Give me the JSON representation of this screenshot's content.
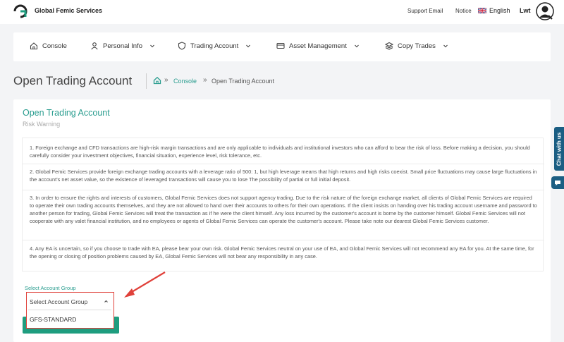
{
  "header": {
    "brand": "Global Femic Services",
    "support_email": "Support Email",
    "notice": "Notice",
    "language": "English",
    "user": "Lwt"
  },
  "nav": {
    "items": [
      {
        "label": "Console",
        "icon": "home-icon",
        "has_dropdown": false
      },
      {
        "label": "Personal Info",
        "icon": "person-icon",
        "has_dropdown": true
      },
      {
        "label": "Trading Account",
        "icon": "shield-icon",
        "has_dropdown": true
      },
      {
        "label": "Asset Management",
        "icon": "card-icon",
        "has_dropdown": true
      },
      {
        "label": "Copy Trades",
        "icon": "layers-icon",
        "has_dropdown": true
      }
    ]
  },
  "page": {
    "title": "Open Trading Account",
    "breadcrumb": {
      "console": "Console",
      "current": "Open Trading Account"
    }
  },
  "card": {
    "title": "Open Trading Account",
    "subtitle": "Risk Warning",
    "paragraphs": [
      "1. Foreign exchange and CFD transactions are high-risk margin transactions and are only applicable to individuals and institutional investors who can afford to bear the risk of loss. Before making a decision, you should carefully consider your investment objectives, financial situation, experience level, risk tolerance, etc.",
      "2. Global Femic Services provide foreign exchange trading accounts with a leverage ratio of 500: 1, but high leverage means that high returns and high risks coexist. Small price fluctuations may cause large fluctuations in the account's net asset value, so the existence of leveraged transactions will cause you to lose The possibility of partial or full initial deposit.",
      "3. In order to ensure the rights and interests of customers, Global Femic Services does not support agency trading. Due to the risk nature of the foreign exchange market, all clients of Global Femic Services are required to operate their own trading accounts themselves, and they are not allowed to hand over their accounts to others for their own operations. If the client insists on handing over his trading account username and password to another person for trading, Global Femic Services will treat the transaction as if he were the client himself. Any loss incurred by the customer's account is borne by the customer himself. Global Femic Services will not cooperate with any valet financial institution, and no employees or agents of Global Femic Services can operate the customer's account. Please take note our dearest Global Femic Services customer.",
      "4. Any EA is uncertain, so if you choose to trade with EA, please bear your own risk. Global Femic Services neutral on your use of EA, and Global Femic Services will not recommend any EA for you. At the same time, for the opening or closing of position problems caused by EA, Global Femic Services will not bear any responsibility in any case."
    ],
    "select_label": "Select Account Group",
    "select_placeholder": "Select Account Group",
    "options": [
      "GFS-STANDARD"
    ]
  },
  "chat": {
    "label": "Chat with us"
  },
  "colors": {
    "accent": "#2a9d8f",
    "button": "#1f9d7f",
    "highlight": "#e0413a",
    "chat": "#1b5e83"
  }
}
